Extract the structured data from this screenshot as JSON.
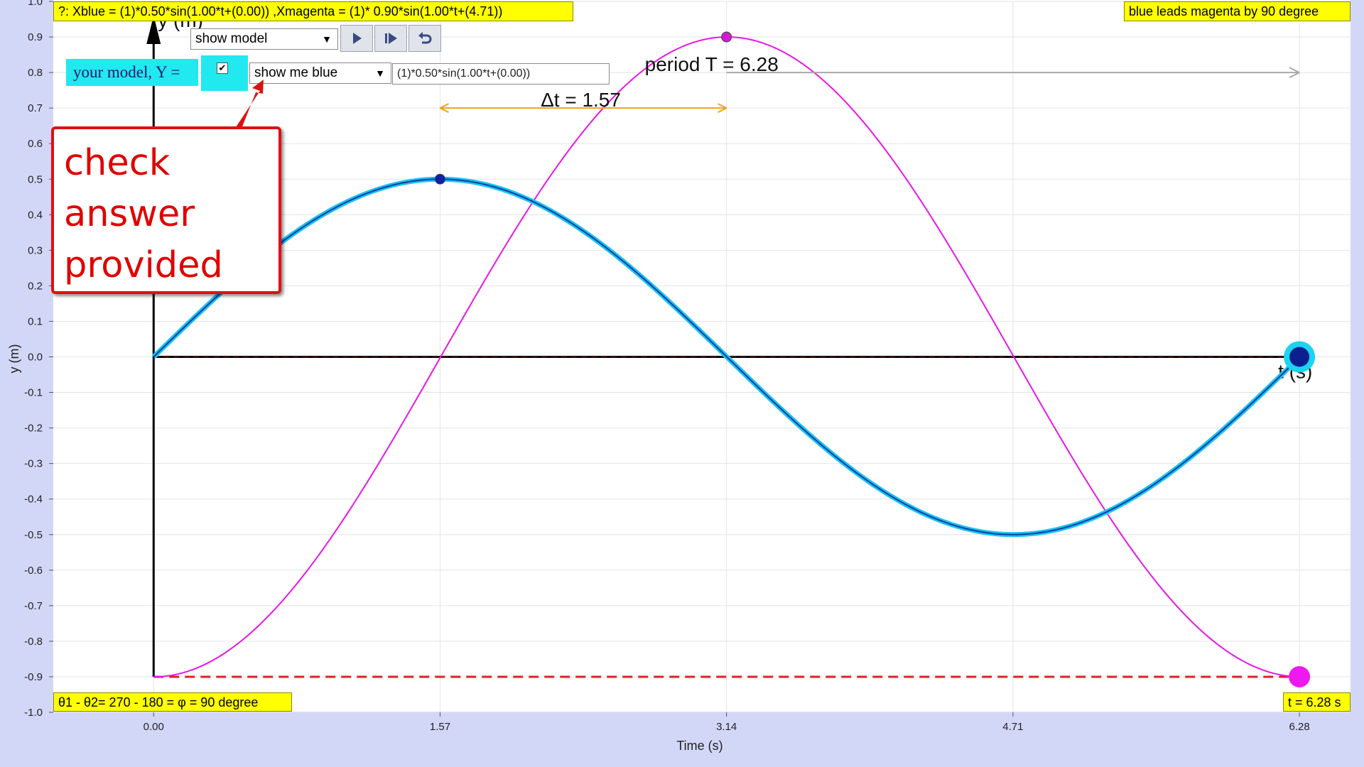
{
  "chart_data": {
    "type": "line",
    "xlabel": "Time (s)",
    "ylabel": "y (m)",
    "xlim": [
      -0.55,
      6.56
    ],
    "ylim": [
      -1.0,
      1.0
    ],
    "xticks": [
      "0.00",
      "1.57",
      "3.14",
      "4.71",
      "6.28"
    ],
    "yticks": [
      "1.0",
      "0.9",
      "0.8",
      "0.7",
      "0.6",
      "0.5",
      "0.4",
      "0.3",
      "0.2",
      "0.1",
      "0.0",
      "-0.1",
      "-0.2",
      "-0.3",
      "-0.4",
      "-0.5",
      "-0.6",
      "-0.7",
      "-0.8",
      "-0.9",
      "-1.0"
    ],
    "grid": true,
    "series": [
      {
        "amplitude": 0.5,
        "omega": 1.0,
        "phase": 0.0,
        "t_range": [
          0,
          6.28
        ],
        "color": "#0a3f9e",
        "glow": "#19c3f5"
      },
      {
        "amplitude": 0.9,
        "omega": 1.0,
        "phase": 4.71,
        "t_range": [
          0,
          6.28
        ],
        "color": "#e817e8"
      }
    ],
    "markers": [
      {
        "x": 1.57,
        "y": 0.5,
        "color": "#0a23a8"
      },
      {
        "x": 3.14,
        "y": 0.9,
        "color": "#d21bd2"
      }
    ],
    "end_markers": [
      {
        "x": 6.28,
        "y": 0.0,
        "fill": "#0b1f8f",
        "ring": "#1ad4f0"
      },
      {
        "x": 6.28,
        "y": -0.9,
        "fill": "#f018f0"
      }
    ],
    "dashed_line_y": -0.9,
    "dashed_color": "#dd2222",
    "axis_origin": [
      0,
      0
    ],
    "y_axis_arrow_label": "y (m)",
    "t_axis_label": "t (s)",
    "period_arrow": {
      "x_start": 3.14,
      "x_end": 6.28,
      "y": 0.8,
      "label": "period T = 6.28",
      "color": "#a8a8a8"
    },
    "delta_arrow": {
      "x_start": 1.57,
      "x_end": 3.14,
      "y": 0.7,
      "label": "Δt = 1.57",
      "color": "#f0a020"
    }
  },
  "info": {
    "equation": "?: Xblue = (1)*0.50*sin(1.00*t+(0.00)) ,Xmagenta = (1)* 0.90*sin(1.00*t+(4.71))",
    "lead_text": "blue leads magenta by 90 degree",
    "phase_text": "θ1 - θ2= 270 - 180 = φ = 90 degree",
    "time_text": "t = 6.28 s"
  },
  "controls": {
    "model_select": "show model",
    "model_label": "your model, Y =",
    "show_select": "show me blue",
    "expression": "(1)*0.50*sin(1.00*t+(0.00))",
    "checkbox_checked": true
  },
  "callout": {
    "lines": [
      "check",
      "answer",
      "provided"
    ]
  },
  "colors": {
    "frame_bg": "#d3d7f7",
    "info_box": "#ffff00",
    "label_box": "#22e8f0",
    "callout_border": "#dd1111",
    "callout_text": "#e00000"
  }
}
